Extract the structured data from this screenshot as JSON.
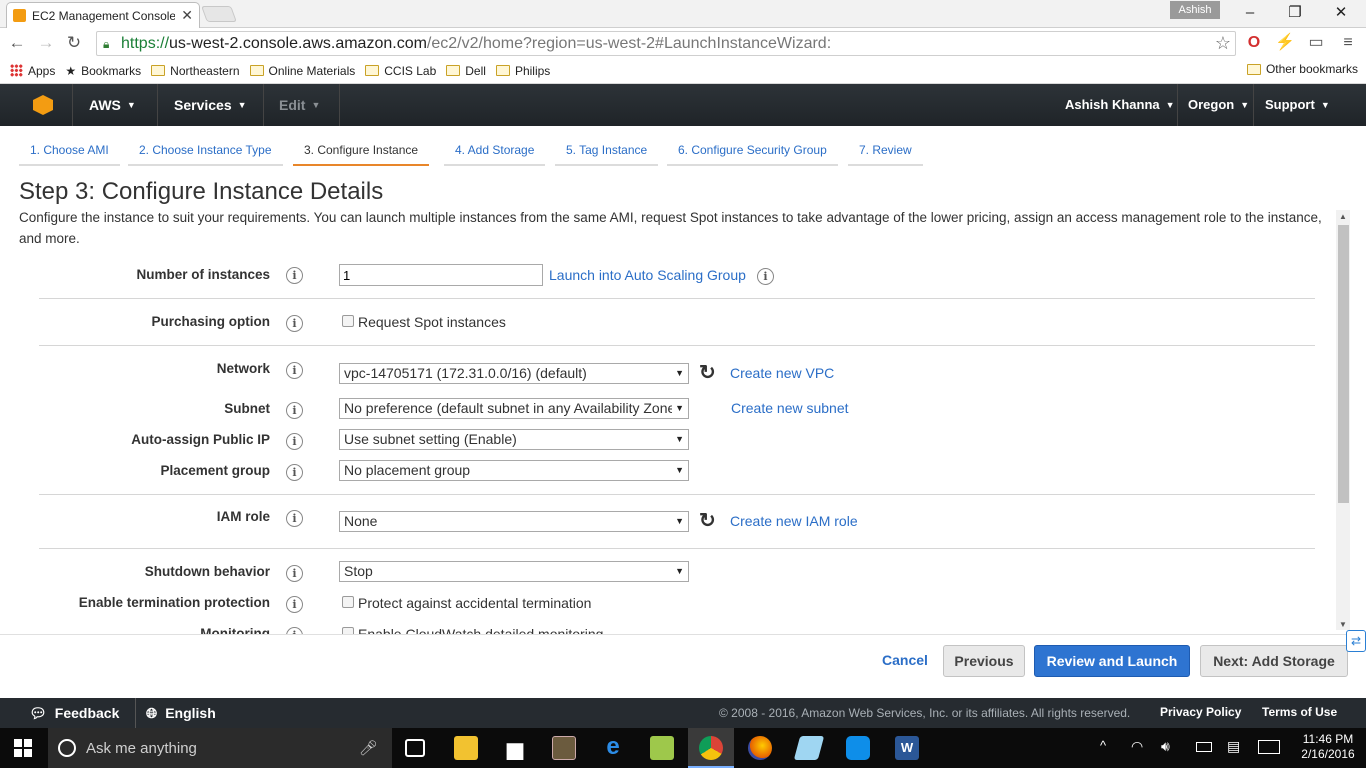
{
  "browser": {
    "tab_title": "EC2 Management Console",
    "profile": "Ashish",
    "url_scheme": "https://",
    "url_host": "us-west-2.console.aws.amazon.com",
    "url_path": "/ec2/v2/home?region=us-west-2#LaunchInstanceWizard:",
    "bookmarks": [
      "Apps",
      "Bookmarks",
      "Northeastern",
      "Online Materials",
      "CCIS Lab",
      "Dell",
      "Philips"
    ],
    "other_bookmarks": "Other bookmarks"
  },
  "awsnav": {
    "brand": "AWS",
    "services": "Services",
    "edit": "Edit",
    "user": "Ashish Khanna",
    "region": "Oregon",
    "support": "Support"
  },
  "wizard": {
    "steps": [
      "1. Choose AMI",
      "2. Choose Instance Type",
      "3. Configure Instance",
      "4. Add Storage",
      "5. Tag Instance",
      "6. Configure Security Group",
      "7. Review"
    ],
    "active_step": 3,
    "title": "Step 3: Configure Instance Details",
    "description": "Configure the instance to suit your requirements. You can launch multiple instances from the same AMI, request Spot instances to take advantage of the lower pricing, assign an access management role to the instance, and more."
  },
  "form": {
    "num_instances_label": "Number of instances",
    "num_instances_value": "1",
    "autoscaling_link": "Launch into Auto Scaling Group",
    "purchasing_label": "Purchasing option",
    "spot_label": "Request Spot instances",
    "network_label": "Network",
    "network_value": "vpc-14705171 (172.31.0.0/16) (default)",
    "create_vpc": "Create new VPC",
    "subnet_label": "Subnet",
    "subnet_value": "No preference (default subnet in any Availability Zone)",
    "create_subnet": "Create new subnet",
    "public_ip_label": "Auto-assign Public IP",
    "public_ip_value": "Use subnet setting (Enable)",
    "placement_label": "Placement group",
    "placement_value": "No placement group",
    "iam_label": "IAM role",
    "iam_value": "None",
    "create_iam": "Create new IAM role",
    "shutdown_label": "Shutdown behavior",
    "shutdown_value": "Stop",
    "termination_label": "Enable termination protection",
    "termination_check": "Protect against accidental termination",
    "monitoring_label": "Monitoring",
    "monitoring_check": "Enable CloudWatch detailed monitoring"
  },
  "buttons": {
    "cancel": "Cancel",
    "previous": "Previous",
    "review": "Review and Launch",
    "next": "Next: Add Storage"
  },
  "footer": {
    "feedback": "Feedback",
    "language": "English",
    "copyright": "© 2008 - 2016, Amazon Web Services, Inc. or its affiliates. All rights reserved.",
    "privacy": "Privacy Policy",
    "terms": "Terms of Use"
  },
  "taskbar": {
    "search_placeholder": "Ask me anything",
    "time": "11:46 PM",
    "date": "2/16/2016"
  },
  "colors": {
    "link": "#2b6ec7",
    "primary_button": "#2e74d1",
    "active_tab_underline": "#e8862a",
    "nav_bg": "#2d3338"
  }
}
